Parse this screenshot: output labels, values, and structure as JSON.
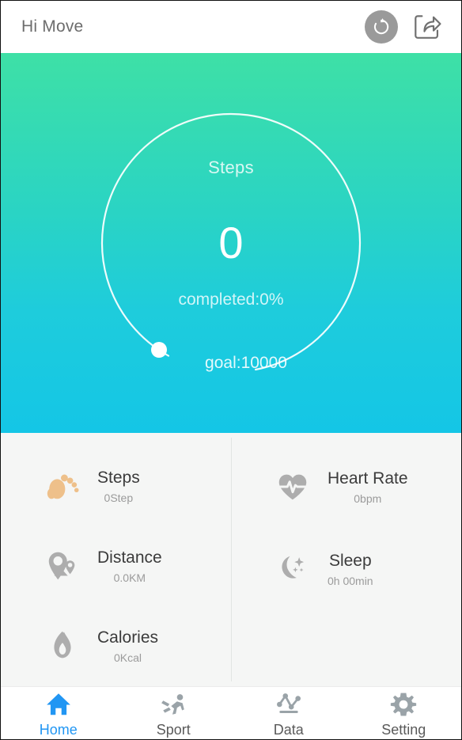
{
  "header": {
    "title": "Hi Move",
    "refresh_icon": "refresh-icon",
    "share_icon": "share-icon"
  },
  "hero": {
    "metric_label": "Steps",
    "value": "0",
    "completed": "completed:0%",
    "goal": "goal:10000",
    "progress_percent": 0,
    "goal_value": 10000,
    "gradient_top": "#3ee0a6",
    "gradient_bottom": "#14c6e6",
    "ring_color": "#ffffff",
    "marker_icon": "progress-marker-dot"
  },
  "stats": {
    "left": [
      {
        "icon": "footprint-icon",
        "icon_color": "#eec08a",
        "name": "Steps",
        "value": "0Step"
      },
      {
        "icon": "map-pin-icon",
        "icon_color": "#adadad",
        "name": "Distance",
        "value": "0.0KM"
      },
      {
        "icon": "flame-icon",
        "icon_color": "#adadad",
        "name": "Calories",
        "value": "0Kcal"
      }
    ],
    "right": [
      {
        "icon": "heart-pulse-icon",
        "icon_color": "#adadad",
        "name": "Heart Rate",
        "value": "0bpm"
      },
      {
        "icon": "moon-stars-icon",
        "icon_color": "#adadad",
        "name": "Sleep",
        "value": "0h 00min"
      }
    ]
  },
  "nav": {
    "active_color": "#2196f3",
    "inactive_color": "#8a9499",
    "items": [
      {
        "icon": "home-icon",
        "label": "Home",
        "active": true
      },
      {
        "icon": "runner-icon",
        "label": "Sport",
        "active": false
      },
      {
        "icon": "chart-icon",
        "label": "Data",
        "active": false
      },
      {
        "icon": "gear-icon",
        "label": "Setting",
        "active": false
      }
    ]
  }
}
